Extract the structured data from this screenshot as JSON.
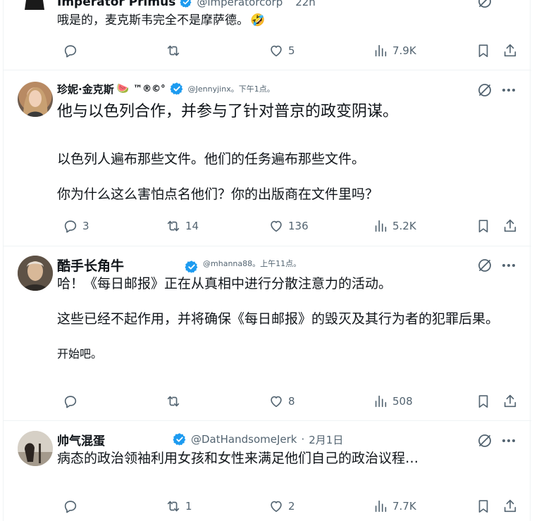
{
  "posts": [
    {
      "name": "Imperator Primus",
      "handle": "@imperatorcorp",
      "time": "22h",
      "text": "哦是的，麦克斯韦完全不是摩萨德。",
      "emoji": "🤣",
      "stats": {
        "replies": "",
        "reposts": "",
        "likes": "5",
        "views": "7.9K"
      }
    },
    {
      "name": "珍妮·金克斯",
      "name_emoji": "🍉",
      "name_suffix": "™®©°",
      "handle": "@Jennyjinx。下午1点。",
      "lines": [
        "他与以色列合作，并参与了针对普京的政变阴谋。",
        "以色列人遍布那些文件。他们的任务遍布那些文件。",
        "你为什么这么害怕点名他们？你的出版商在文件里吗？"
      ],
      "stats": {
        "replies": "3",
        "reposts": "14",
        "likes": "136",
        "views": "5.2K"
      }
    },
    {
      "name": "酷手长角牛",
      "handle": "@mhanna88。上午11点。",
      "lines": [
        "哈！《每日邮报》正在从真相中进行分散注意力的活动。",
        "这些已经不起作用，并将确保《每日邮报》的毁灭及其行为者的犯罪后果。",
        "开始吧。"
      ],
      "stats": {
        "replies": "",
        "reposts": "",
        "likes": "8",
        "views": "508"
      }
    },
    {
      "name": "帅气混蛋",
      "handle": "@DatHandsomeJerk",
      "sep": "·",
      "time": "2月1日",
      "text": "病态的政治领袖利用女孩和女性来满足他们自己的政治议程…",
      "stats": {
        "replies": "",
        "reposts": "1",
        "likes": "2",
        "views": "7.7K"
      }
    }
  ],
  "colors": {
    "verified": "#1d9bf0",
    "muted": "#536471",
    "text": "#0f1419",
    "border": "#eff3f4"
  },
  "icons": [
    "reply-icon",
    "repost-icon",
    "like-icon",
    "views-icon",
    "bookmark-icon",
    "share-icon",
    "grok-icon",
    "more-icon",
    "verified-badge-icon"
  ]
}
